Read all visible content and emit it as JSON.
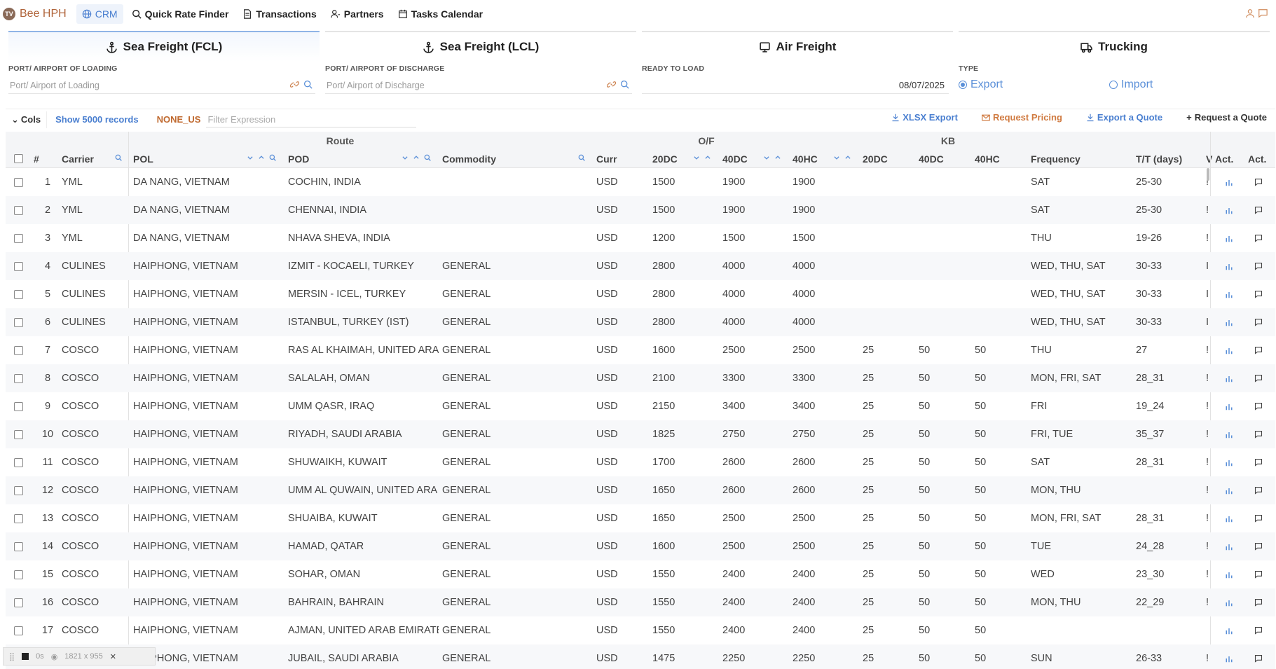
{
  "nav": {
    "brand": "Bee HPH",
    "brand_logo": "TV",
    "items": [
      {
        "label": "CRM",
        "icon": "globe-icon"
      },
      {
        "label": "Quick Rate Finder",
        "icon": "search-icon"
      },
      {
        "label": "Transactions",
        "icon": "document-icon"
      },
      {
        "label": "Partners",
        "icon": "user-icon"
      },
      {
        "label": "Tasks Calendar",
        "icon": "calendar-icon"
      }
    ]
  },
  "modes": [
    {
      "label": "Sea Freight (FCL)",
      "icon": "anchor-icon",
      "active": true
    },
    {
      "label": "Sea Freight (LCL)",
      "icon": "anchor-icon",
      "active": false
    },
    {
      "label": "Air Freight",
      "icon": "plane-icon",
      "active": false
    },
    {
      "label": "Trucking",
      "icon": "truck-icon",
      "active": false
    }
  ],
  "filters": {
    "loading_label": "PORT/ AIRPORT OF LOADING",
    "loading_placeholder": "Port/ Airport of Loading",
    "discharge_label": "PORT/ AIRPORT OF DISCHARGE",
    "discharge_placeholder": "Port/ Airport of Discharge",
    "ready_label": "READY TO LOAD",
    "ready_value": "08/07/2025",
    "type_label": "TYPE",
    "type_export": "Export",
    "type_import": "Import",
    "type_selected": "Export"
  },
  "toolbar": {
    "cols": "Cols",
    "show": "Show 5000 records",
    "none_us": "NONE_US",
    "filter_placeholder": "Filter Expression",
    "xlsx": "XLSX Export",
    "request_pricing": "Request Pricing",
    "export_quote": "Export a Quote",
    "request_quote": "Request a Quote"
  },
  "table": {
    "groups": {
      "route": "Route",
      "of": "O/F",
      "kb": "KB"
    },
    "headers": {
      "num": "#",
      "carrier": "Carrier",
      "pol": "POL",
      "pod": "POD",
      "commodity": "Commodity",
      "curr": "Curr",
      "of20": "20DC",
      "of40": "40DC",
      "of40hc": "40HC",
      "kb20": "20DC",
      "kb40": "40DC",
      "kb40hc": "40HC",
      "freq": "Frequency",
      "tt": "T/T (days)",
      "v": "V",
      "act1": "Act.",
      "act2": "Act."
    },
    "rows": [
      {
        "n": "1",
        "carrier": "YML",
        "pol": "DA NANG, VIETNAM",
        "pod": "COCHIN, INDIA",
        "com": "",
        "curr": "USD",
        "a": "1500",
        "b": "1900",
        "c": "1900",
        "d": "",
        "e": "",
        "f": "",
        "freq": "SAT",
        "tt": "25-30",
        "v": "!"
      },
      {
        "n": "2",
        "carrier": "YML",
        "pol": "DA NANG, VIETNAM",
        "pod": "CHENNAI, INDIA",
        "com": "",
        "curr": "USD",
        "a": "1500",
        "b": "1900",
        "c": "1900",
        "d": "",
        "e": "",
        "f": "",
        "freq": "SAT",
        "tt": "25-30",
        "v": "!"
      },
      {
        "n": "3",
        "carrier": "YML",
        "pol": "DA NANG, VIETNAM",
        "pod": "NHAVA SHEVA, INDIA",
        "com": "",
        "curr": "USD",
        "a": "1200",
        "b": "1500",
        "c": "1500",
        "d": "",
        "e": "",
        "f": "",
        "freq": "THU",
        "tt": "19-26",
        "v": "!"
      },
      {
        "n": "4",
        "carrier": "CULINES",
        "pol": "HAIPHONG, VIETNAM",
        "pod": "IZMIT - KOCAELI, TURKEY",
        "com": "GENERAL",
        "curr": "USD",
        "a": "2800",
        "b": "4000",
        "c": "4000",
        "d": "",
        "e": "",
        "f": "",
        "freq": "WED, THU, SAT",
        "tt": "30-33",
        "v": "I"
      },
      {
        "n": "5",
        "carrier": "CULINES",
        "pol": "HAIPHONG, VIETNAM",
        "pod": "MERSIN - ICEL, TURKEY",
        "com": "GENERAL",
        "curr": "USD",
        "a": "2800",
        "b": "4000",
        "c": "4000",
        "d": "",
        "e": "",
        "f": "",
        "freq": "WED, THU, SAT",
        "tt": "30-33",
        "v": "I"
      },
      {
        "n": "6",
        "carrier": "CULINES",
        "pol": "HAIPHONG, VIETNAM",
        "pod": "ISTANBUL, TURKEY (IST)",
        "com": "GENERAL",
        "curr": "USD",
        "a": "2800",
        "b": "4000",
        "c": "4000",
        "d": "",
        "e": "",
        "f": "",
        "freq": "WED, THU, SAT",
        "tt": "30-33",
        "v": "I"
      },
      {
        "n": "7",
        "carrier": "COSCO",
        "pol": "HAIPHONG, VIETNAM",
        "pod": "RAS AL KHAIMAH, UNITED ARA",
        "com": "GENERAL",
        "curr": "USD",
        "a": "1600",
        "b": "2500",
        "c": "2500",
        "d": "25",
        "e": "50",
        "f": "50",
        "freq": "THU",
        "tt": "27",
        "v": "!"
      },
      {
        "n": "8",
        "carrier": "COSCO",
        "pol": "HAIPHONG, VIETNAM",
        "pod": "SALALAH, OMAN",
        "com": "GENERAL",
        "curr": "USD",
        "a": "2100",
        "b": "3300",
        "c": "3300",
        "d": "25",
        "e": "50",
        "f": "50",
        "freq": "MON, FRI, SAT",
        "tt": "28_31",
        "v": "!"
      },
      {
        "n": "9",
        "carrier": "COSCO",
        "pol": "HAIPHONG, VIETNAM",
        "pod": "UMM QASR, IRAQ",
        "com": "GENERAL",
        "curr": "USD",
        "a": "2150",
        "b": "3400",
        "c": "3400",
        "d": "25",
        "e": "50",
        "f": "50",
        "freq": "FRI",
        "tt": "19_24",
        "v": "!"
      },
      {
        "n": "10",
        "carrier": "COSCO",
        "pol": "HAIPHONG, VIETNAM",
        "pod": "RIYADH, SAUDI ARABIA",
        "com": "GENERAL",
        "curr": "USD",
        "a": "1825",
        "b": "2750",
        "c": "2750",
        "d": "25",
        "e": "50",
        "f": "50",
        "freq": "FRI, TUE",
        "tt": "35_37",
        "v": "!"
      },
      {
        "n": "11",
        "carrier": "COSCO",
        "pol": "HAIPHONG, VIETNAM",
        "pod": "SHUWAIKH, KUWAIT",
        "com": "GENERAL",
        "curr": "USD",
        "a": "1700",
        "b": "2600",
        "c": "2600",
        "d": "25",
        "e": "50",
        "f": "50",
        "freq": "SAT",
        "tt": "28_31",
        "v": "!"
      },
      {
        "n": "12",
        "carrier": "COSCO",
        "pol": "HAIPHONG, VIETNAM",
        "pod": "UMM AL QUWAIN, UNITED ARA",
        "com": "GENERAL",
        "curr": "USD",
        "a": "1650",
        "b": "2600",
        "c": "2600",
        "d": "25",
        "e": "50",
        "f": "50",
        "freq": "MON, THU",
        "tt": "",
        "v": "!"
      },
      {
        "n": "13",
        "carrier": "COSCO",
        "pol": "HAIPHONG, VIETNAM",
        "pod": "SHUAIBA, KUWAIT",
        "com": "GENERAL",
        "curr": "USD",
        "a": "1650",
        "b": "2500",
        "c": "2500",
        "d": "25",
        "e": "50",
        "f": "50",
        "freq": "MON, FRI, SAT",
        "tt": "28_31",
        "v": "!"
      },
      {
        "n": "14",
        "carrier": "COSCO",
        "pol": "HAIPHONG, VIETNAM",
        "pod": "HAMAD, QATAR",
        "com": "GENERAL",
        "curr": "USD",
        "a": "1600",
        "b": "2500",
        "c": "2500",
        "d": "25",
        "e": "50",
        "f": "50",
        "freq": "TUE",
        "tt": "24_28",
        "v": "!"
      },
      {
        "n": "15",
        "carrier": "COSCO",
        "pol": "HAIPHONG, VIETNAM",
        "pod": "SOHAR, OMAN",
        "com": "GENERAL",
        "curr": "USD",
        "a": "1550",
        "b": "2400",
        "c": "2400",
        "d": "25",
        "e": "50",
        "f": "50",
        "freq": "WED",
        "tt": "23_30",
        "v": "!"
      },
      {
        "n": "16",
        "carrier": "COSCO",
        "pol": "HAIPHONG, VIETNAM",
        "pod": "BAHRAIN, BAHRAIN",
        "com": "GENERAL",
        "curr": "USD",
        "a": "1550",
        "b": "2400",
        "c": "2400",
        "d": "25",
        "e": "50",
        "f": "50",
        "freq": "MON, THU",
        "tt": "22_29",
        "v": "!"
      },
      {
        "n": "17",
        "carrier": "COSCO",
        "pol": "HAIPHONG, VIETNAM",
        "pod": "AJMAN, UNITED ARAB EMIRATE",
        "com": "GENERAL",
        "curr": "USD",
        "a": "1550",
        "b": "2400",
        "c": "2400",
        "d": "25",
        "e": "50",
        "f": "50",
        "freq": "",
        "tt": "",
        "v": ""
      },
      {
        "n": "18",
        "carrier": "COSCO",
        "pol": "HAIPHONG, VIETNAM",
        "pod": "JUBAIL, SAUDI ARABIA",
        "com": "GENERAL",
        "curr": "USD",
        "a": "1475",
        "b": "2250",
        "c": "2250",
        "d": "25",
        "e": "50",
        "f": "50",
        "freq": "SUN",
        "tt": "26-33",
        "v": "!"
      }
    ]
  },
  "floatbar": {
    "time": "0s",
    "size": "1821 x 955"
  },
  "colors": {
    "accent": "#4a7fd0",
    "orange": "#c06a30"
  }
}
